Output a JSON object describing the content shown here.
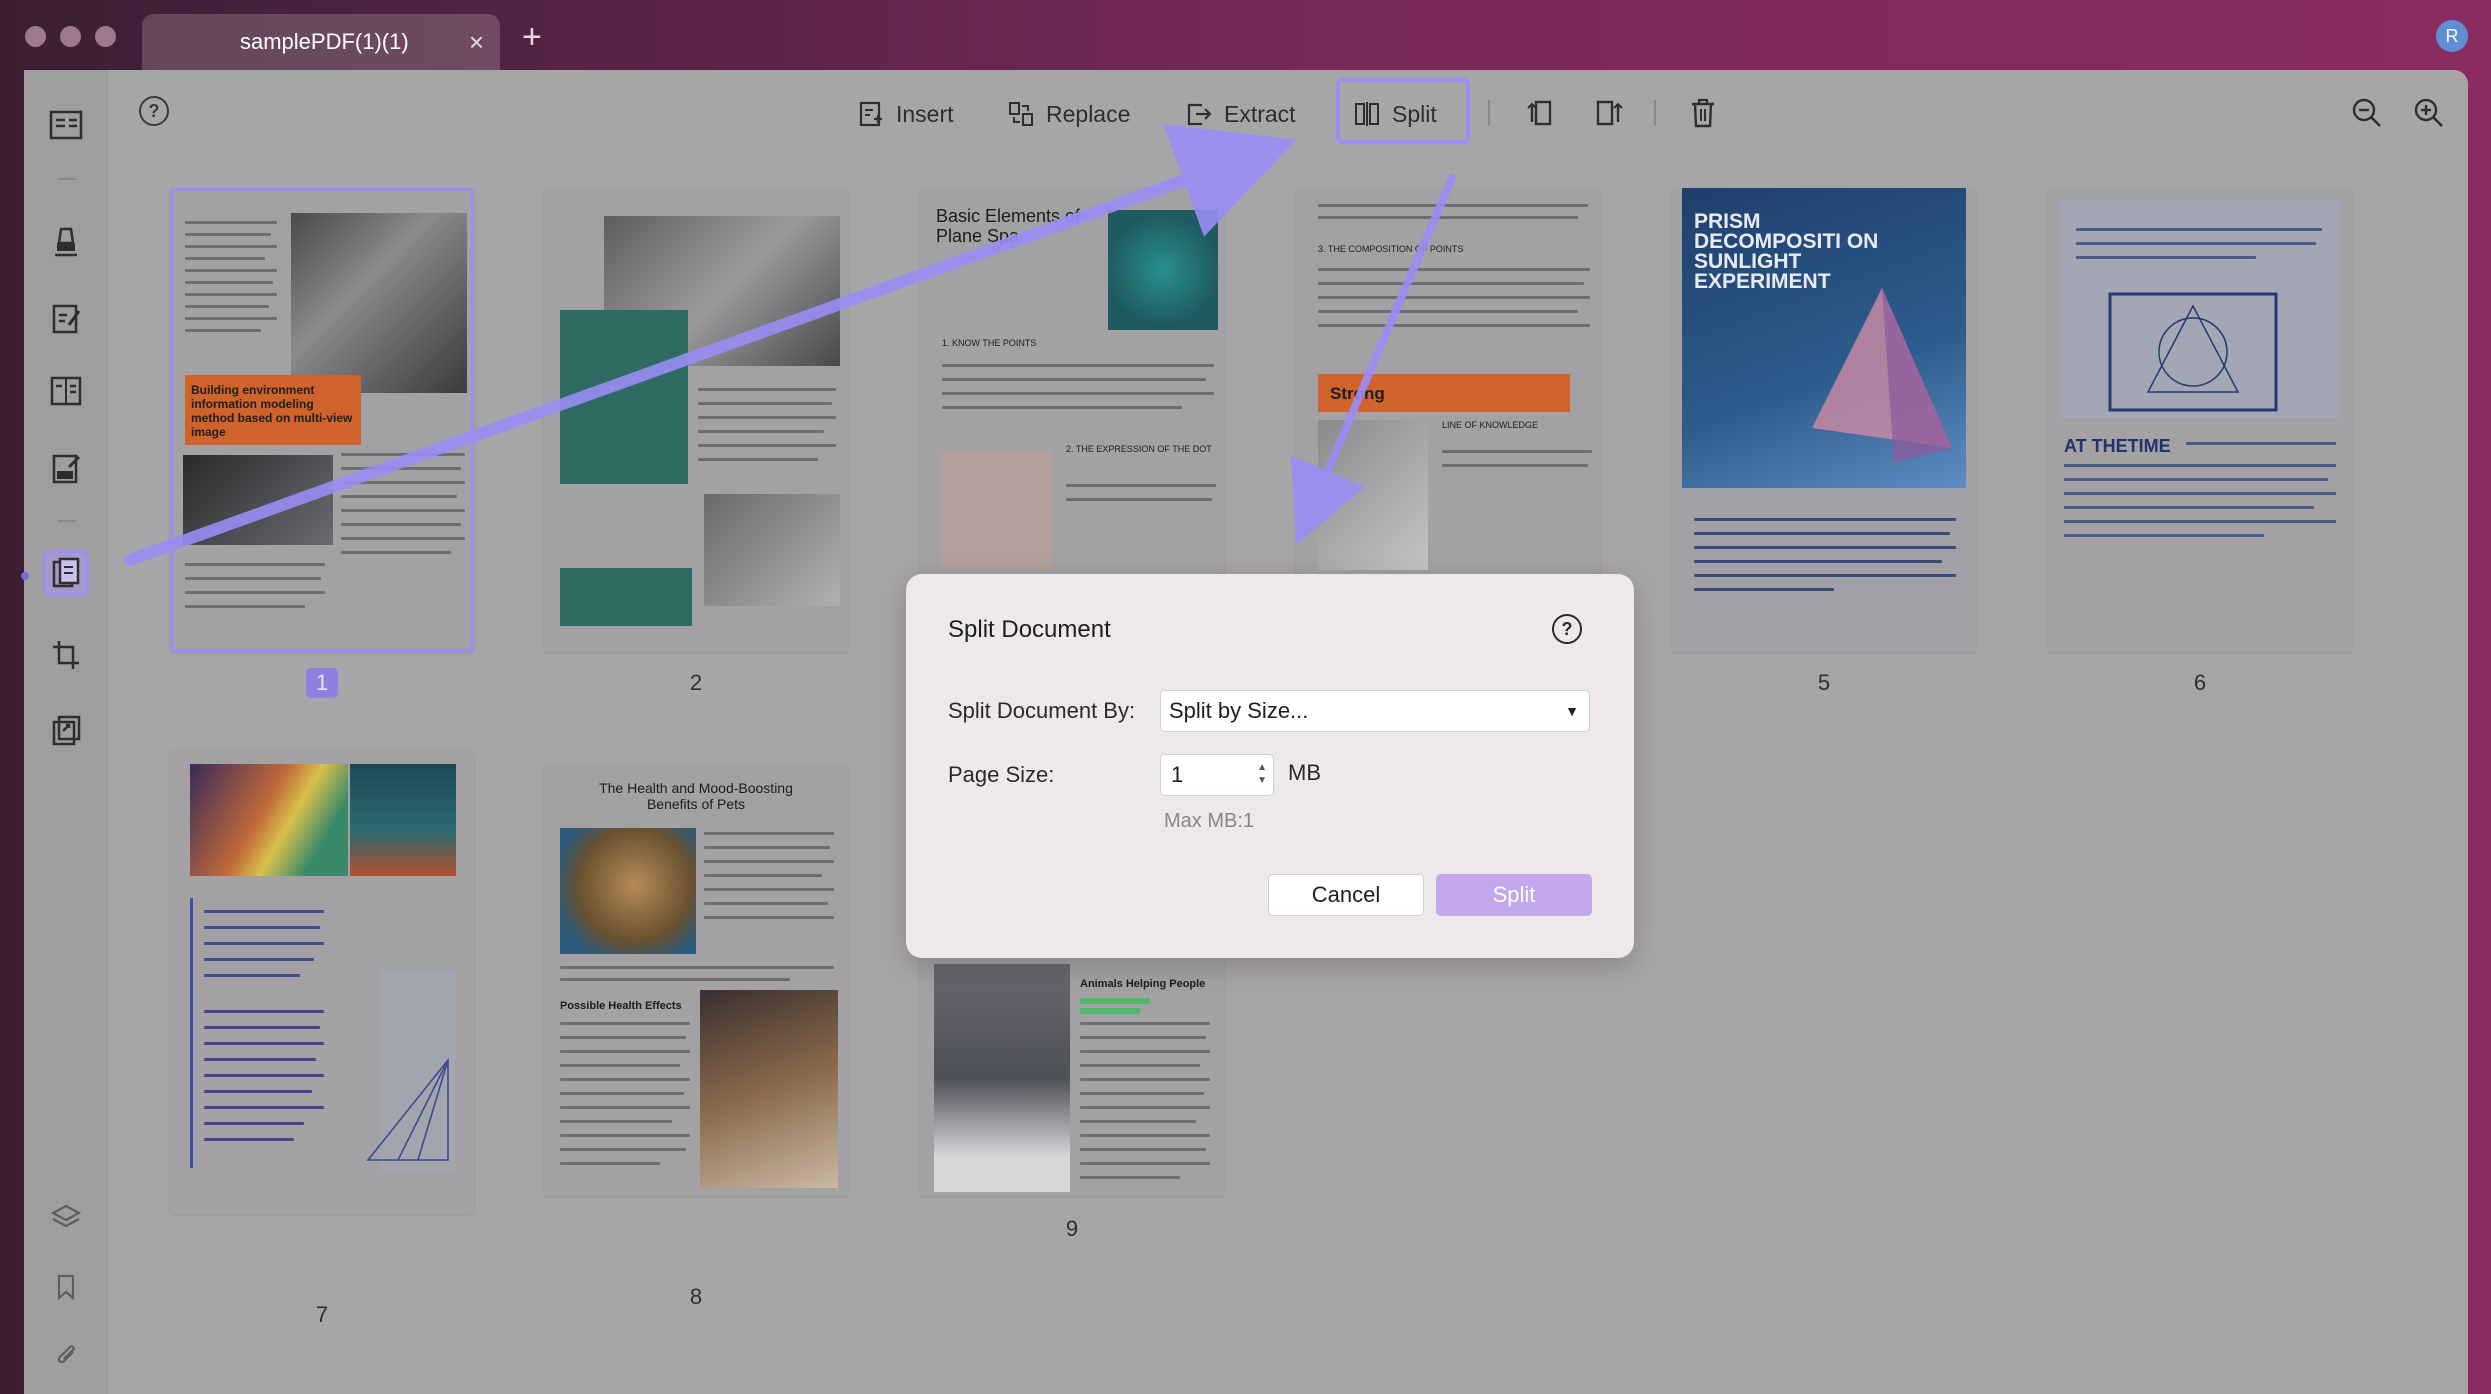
{
  "window": {
    "tab_title": "samplePDF(1)(1)",
    "tab_close": "×",
    "tab_add": "+",
    "avatar_letter": "R"
  },
  "toolbar": {
    "help": "?",
    "insert": "Insert",
    "replace": "Replace",
    "extract": "Extract",
    "split": "Split"
  },
  "pages": [
    {
      "number": "1",
      "heading": "Building environment information modeling method based on multi-view image"
    },
    {
      "number": "2"
    },
    {
      "number": "3",
      "heading": "Basic Elements of Plane Spa",
      "section1": "1. KNOW THE POINTS",
      "section2": "2. THE EXPRESSION OF THE DOT"
    },
    {
      "number": "4",
      "section1": "3. THE COMPOSITION OF POINTS",
      "band": "Strong",
      "section2": "LINE OF KNOWLEDGE"
    },
    {
      "number": "5",
      "heading": "PRISM DECOMPOSITI ON SUNLIGHT EXPERIMENT"
    },
    {
      "number": "6",
      "heading": "AT THETIME"
    },
    {
      "number": "7"
    },
    {
      "number": "8",
      "heading": "The Health and Mood-Boosting Benefits of Pets",
      "section1": "Possible Health Effects"
    },
    {
      "number": "9",
      "section1": "Animals Helping People"
    }
  ],
  "dialog": {
    "title": "Split Document",
    "help": "?",
    "split_by_label": "Split Document By:",
    "split_by_value": "Split by Size...",
    "page_size_label": "Page Size:",
    "page_size_value": "1",
    "unit": "MB",
    "max_note": "Max MB:1",
    "cancel": "Cancel",
    "split": "Split"
  },
  "colors": {
    "accent": "#9a8df5",
    "split_button": "#c3a7ee",
    "window_bg": "#a8a5a8",
    "orange_band": "#d0622c"
  }
}
